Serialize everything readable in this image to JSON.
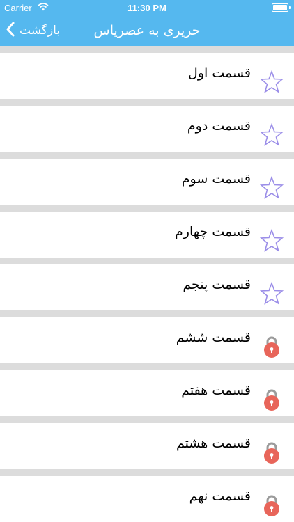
{
  "status_bar": {
    "carrier": "Carrier",
    "time": "11:30 PM"
  },
  "nav": {
    "back_label": "بازگشت",
    "title": "حریری به عصریاس"
  },
  "colors": {
    "bar": "#55b8ef",
    "star": "#9b8ee8",
    "lock": "#e8655a",
    "separator": "#dcdcdc"
  },
  "episodes": [
    {
      "label": "قسمت اول",
      "icon": "star-icon"
    },
    {
      "label": "قسمت دوم",
      "icon": "star-icon"
    },
    {
      "label": "قسمت سوم",
      "icon": "star-icon"
    },
    {
      "label": "قسمت چهارم",
      "icon": "star-icon"
    },
    {
      "label": "قسمت پنجم",
      "icon": "star-icon"
    },
    {
      "label": "قسمت ششم",
      "icon": "lock-icon"
    },
    {
      "label": "قسمت هفتم",
      "icon": "lock-icon"
    },
    {
      "label": "قسمت هشتم",
      "icon": "lock-icon"
    },
    {
      "label": "قسمت نهم",
      "icon": "lock-icon"
    }
  ]
}
